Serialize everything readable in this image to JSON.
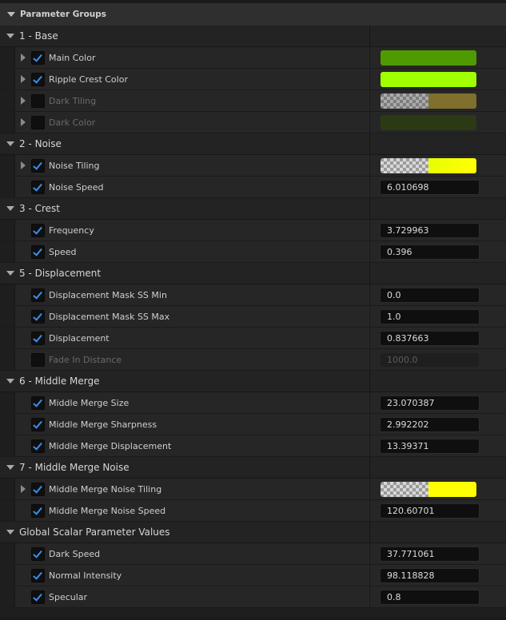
{
  "panel": {
    "title": "Parameter Groups"
  },
  "groups": [
    {
      "label": "1 - Base",
      "params": [
        {
          "label": "Main Color",
          "checked": true,
          "enabled": true,
          "expandable": true,
          "type": "color",
          "color": "#4f9a00",
          "checker": false
        },
        {
          "label": "Ripple Crest Color",
          "checked": true,
          "enabled": true,
          "expandable": true,
          "type": "color",
          "color": "#a0ff00",
          "checker": false
        },
        {
          "label": "Dark Tiling",
          "checked": false,
          "enabled": false,
          "expandable": true,
          "type": "color",
          "color": "#b39b33",
          "checker": true,
          "dim": true
        },
        {
          "label": "Dark Color",
          "checked": false,
          "enabled": false,
          "expandable": true,
          "type": "color",
          "color": "#2b3a14",
          "checker": false
        }
      ]
    },
    {
      "label": "2 - Noise",
      "params": [
        {
          "label": "Noise Tiling",
          "checked": true,
          "enabled": true,
          "expandable": true,
          "type": "color",
          "color": "#f0ff00",
          "checker": true,
          "gradient": true
        },
        {
          "label": "Noise Speed",
          "checked": true,
          "enabled": true,
          "expandable": false,
          "type": "number",
          "value": "6.010698"
        }
      ]
    },
    {
      "label": "3 - Crest",
      "params": [
        {
          "label": "Frequency",
          "checked": true,
          "enabled": true,
          "expandable": false,
          "type": "number",
          "value": "3.729963"
        },
        {
          "label": "Speed",
          "checked": true,
          "enabled": true,
          "expandable": false,
          "type": "number",
          "value": "0.396"
        }
      ]
    },
    {
      "label": "5 - Displacement",
      "params": [
        {
          "label": "Displacement Mask SS Min",
          "checked": true,
          "enabled": true,
          "expandable": false,
          "type": "number",
          "value": "0.0"
        },
        {
          "label": "Displacement Mask SS Max",
          "checked": true,
          "enabled": true,
          "expandable": false,
          "type": "number",
          "value": "1.0"
        },
        {
          "label": "Displacement",
          "checked": true,
          "enabled": true,
          "expandable": false,
          "type": "number",
          "value": "0.837663"
        },
        {
          "label": "Fade In Distance",
          "checked": false,
          "enabled": false,
          "expandable": false,
          "type": "number",
          "value": "1000.0"
        }
      ]
    },
    {
      "label": "6 - Middle Merge",
      "params": [
        {
          "label": "Middle Merge Size",
          "checked": true,
          "enabled": true,
          "expandable": false,
          "type": "number",
          "value": "23.070387"
        },
        {
          "label": "Middle Merge Sharpness",
          "checked": true,
          "enabled": true,
          "expandable": false,
          "type": "number",
          "value": "2.992202"
        },
        {
          "label": "Middle Merge Displacement",
          "checked": true,
          "enabled": true,
          "expandable": false,
          "type": "number",
          "value": "13.39371"
        }
      ]
    },
    {
      "label": "7 - Middle Merge Noise",
      "params": [
        {
          "label": "Middle Merge Noise Tiling",
          "checked": true,
          "enabled": true,
          "expandable": true,
          "type": "color",
          "color": "#ffff00",
          "checker": true
        },
        {
          "label": "Middle Merge Noise Speed",
          "checked": true,
          "enabled": true,
          "expandable": false,
          "type": "number",
          "value": "120.60701"
        }
      ]
    },
    {
      "label": "Global Scalar Parameter Values",
      "params": [
        {
          "label": "Dark Speed",
          "checked": true,
          "enabled": true,
          "expandable": false,
          "type": "number",
          "value": "37.771061"
        },
        {
          "label": "Normal Intensity",
          "checked": true,
          "enabled": true,
          "expandable": false,
          "type": "number",
          "value": "98.118828"
        },
        {
          "label": "Specular",
          "checked": true,
          "enabled": true,
          "expandable": false,
          "type": "number",
          "value": "0.8"
        }
      ]
    }
  ]
}
